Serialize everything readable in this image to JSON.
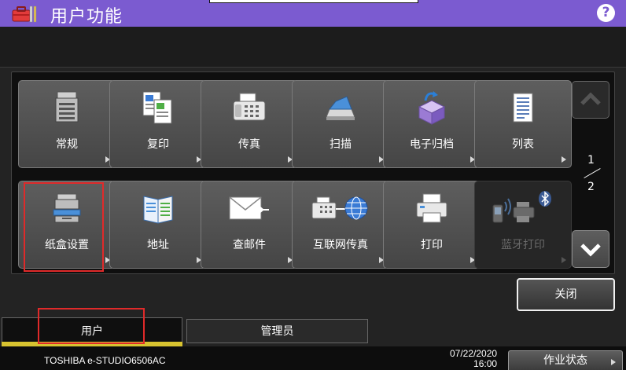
{
  "header": {
    "title": "用户功能",
    "help_label": "?"
  },
  "tiles": [
    {
      "label": "常规",
      "icon": "copier-general-icon",
      "enabled": true
    },
    {
      "label": "复印",
      "icon": "copy-icon",
      "enabled": true
    },
    {
      "label": "传真",
      "icon": "fax-icon",
      "enabled": true
    },
    {
      "label": "扫描",
      "icon": "scanner-icon",
      "enabled": true
    },
    {
      "label": "电子归档",
      "icon": "e-filing-icon",
      "enabled": true
    },
    {
      "label": "列表",
      "icon": "list-icon",
      "enabled": true
    },
    {
      "label": "纸盒设置",
      "icon": "paper-drawer-icon",
      "enabled": true
    },
    {
      "label": "地址",
      "icon": "address-book-icon",
      "enabled": true
    },
    {
      "label": "查邮件",
      "icon": "envelope-icon",
      "enabled": true
    },
    {
      "label": "互联网传真",
      "icon": "internet-fax-icon",
      "enabled": true
    },
    {
      "label": "打印",
      "icon": "printer-icon",
      "enabled": true
    },
    {
      "label": "蓝牙打印",
      "icon": "bluetooth-print-icon",
      "enabled": false
    }
  ],
  "pager": {
    "current": "1",
    "total": "2"
  },
  "close_label": "关闭",
  "tabs": {
    "user": "用户",
    "admin": "管理员"
  },
  "footer": {
    "model": "TOSHIBA e-STUDIO6506AC",
    "date": "07/22/2020",
    "time": "16:00",
    "job_status_label": "作业状态"
  },
  "colors": {
    "header_bg": "#7b5bd0",
    "selection_outline": "#e02a2a",
    "active_tab_accent": "#d8c330"
  }
}
